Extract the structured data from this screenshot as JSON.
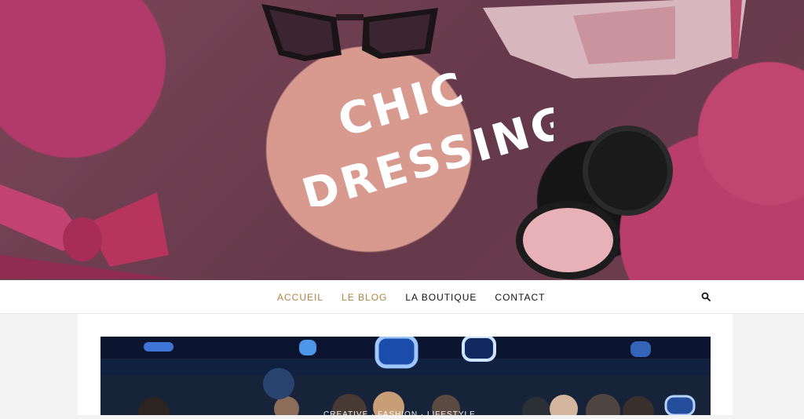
{
  "hero": {
    "title_line1": "CHIC",
    "title_line2": "DRESSING"
  },
  "nav": {
    "items": [
      {
        "label": "ACCUEIL"
      },
      {
        "label": "LE BLOG"
      },
      {
        "label": "LA BOUTIQUE"
      },
      {
        "label": "CONTACT"
      }
    ],
    "search_icon": "search-icon"
  },
  "feature": {
    "categories": "CREATIVE · FASHION · LIFESTYLE"
  },
  "colors": {
    "accent": "#b1833f",
    "nav_text": "#111111",
    "page_bg": "#f3f3f3"
  }
}
